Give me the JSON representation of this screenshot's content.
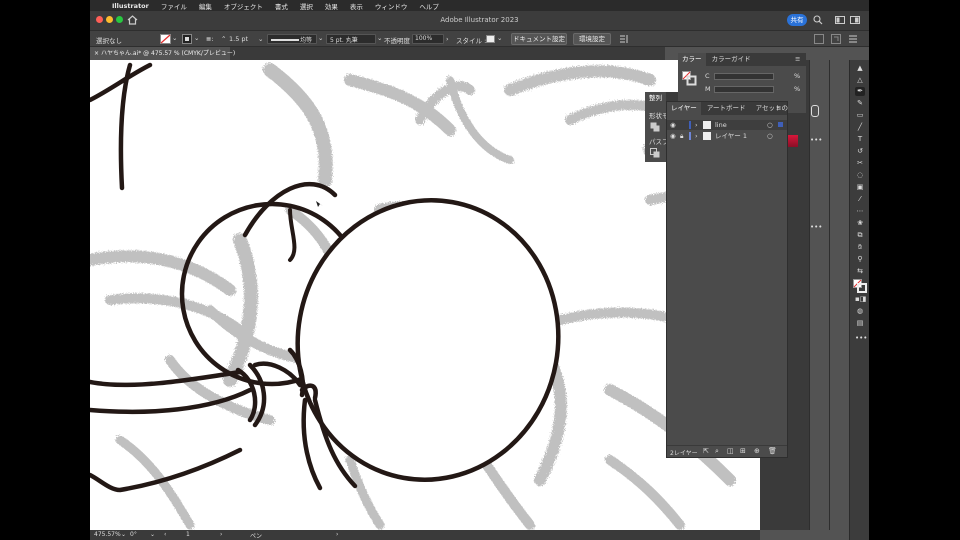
{
  "menubar": {
    "app_name": "Illustrator",
    "items": [
      "ファイル",
      "編集",
      "オブジェクト",
      "書式",
      "選択",
      "効果",
      "表示",
      "ウィンドウ",
      "ヘルプ"
    ]
  },
  "titlebar": {
    "title": "Adobe Illustrator 2023",
    "share_label": "共有"
  },
  "control_bar": {
    "selection": "選択なし",
    "stroke_weight": "1.5 pt",
    "profile": "均等",
    "brush": "5 pt. 丸筆",
    "opacity_label": "不透明度 :",
    "opacity_value": "100%",
    "style_label": "スタイル :",
    "doc_settings": "ドキュメント設定",
    "preferences": "環境設定"
  },
  "document_tab": {
    "label": "ハヤちゃん.ai* @ 475.57 % (CMYK/プレビュー)"
  },
  "status_bar": {
    "zoom": "475.57%",
    "rotation": "0°",
    "artboard": "1",
    "tool": "ペン"
  },
  "color_panel": {
    "tabs": [
      "カラー",
      "カラーガイド"
    ],
    "channels": [
      {
        "label": "C",
        "unit": "%"
      },
      {
        "label": "M",
        "unit": "%"
      }
    ]
  },
  "align_panel": {
    "tabs": [
      "整列"
    ],
    "row_labels": [
      "形状モ",
      "パスフ"
    ]
  },
  "layers_panel": {
    "tabs": [
      "レイヤー",
      "アートボード",
      "アセットの"
    ],
    "layers": [
      {
        "name": "line"
      },
      {
        "name": "レイヤー 1"
      }
    ],
    "footer_count": "2レイヤー"
  },
  "colors": {
    "accent": "#2a72d8",
    "layer_line": "#3f5fb8",
    "layer1": "#6e86d8"
  }
}
